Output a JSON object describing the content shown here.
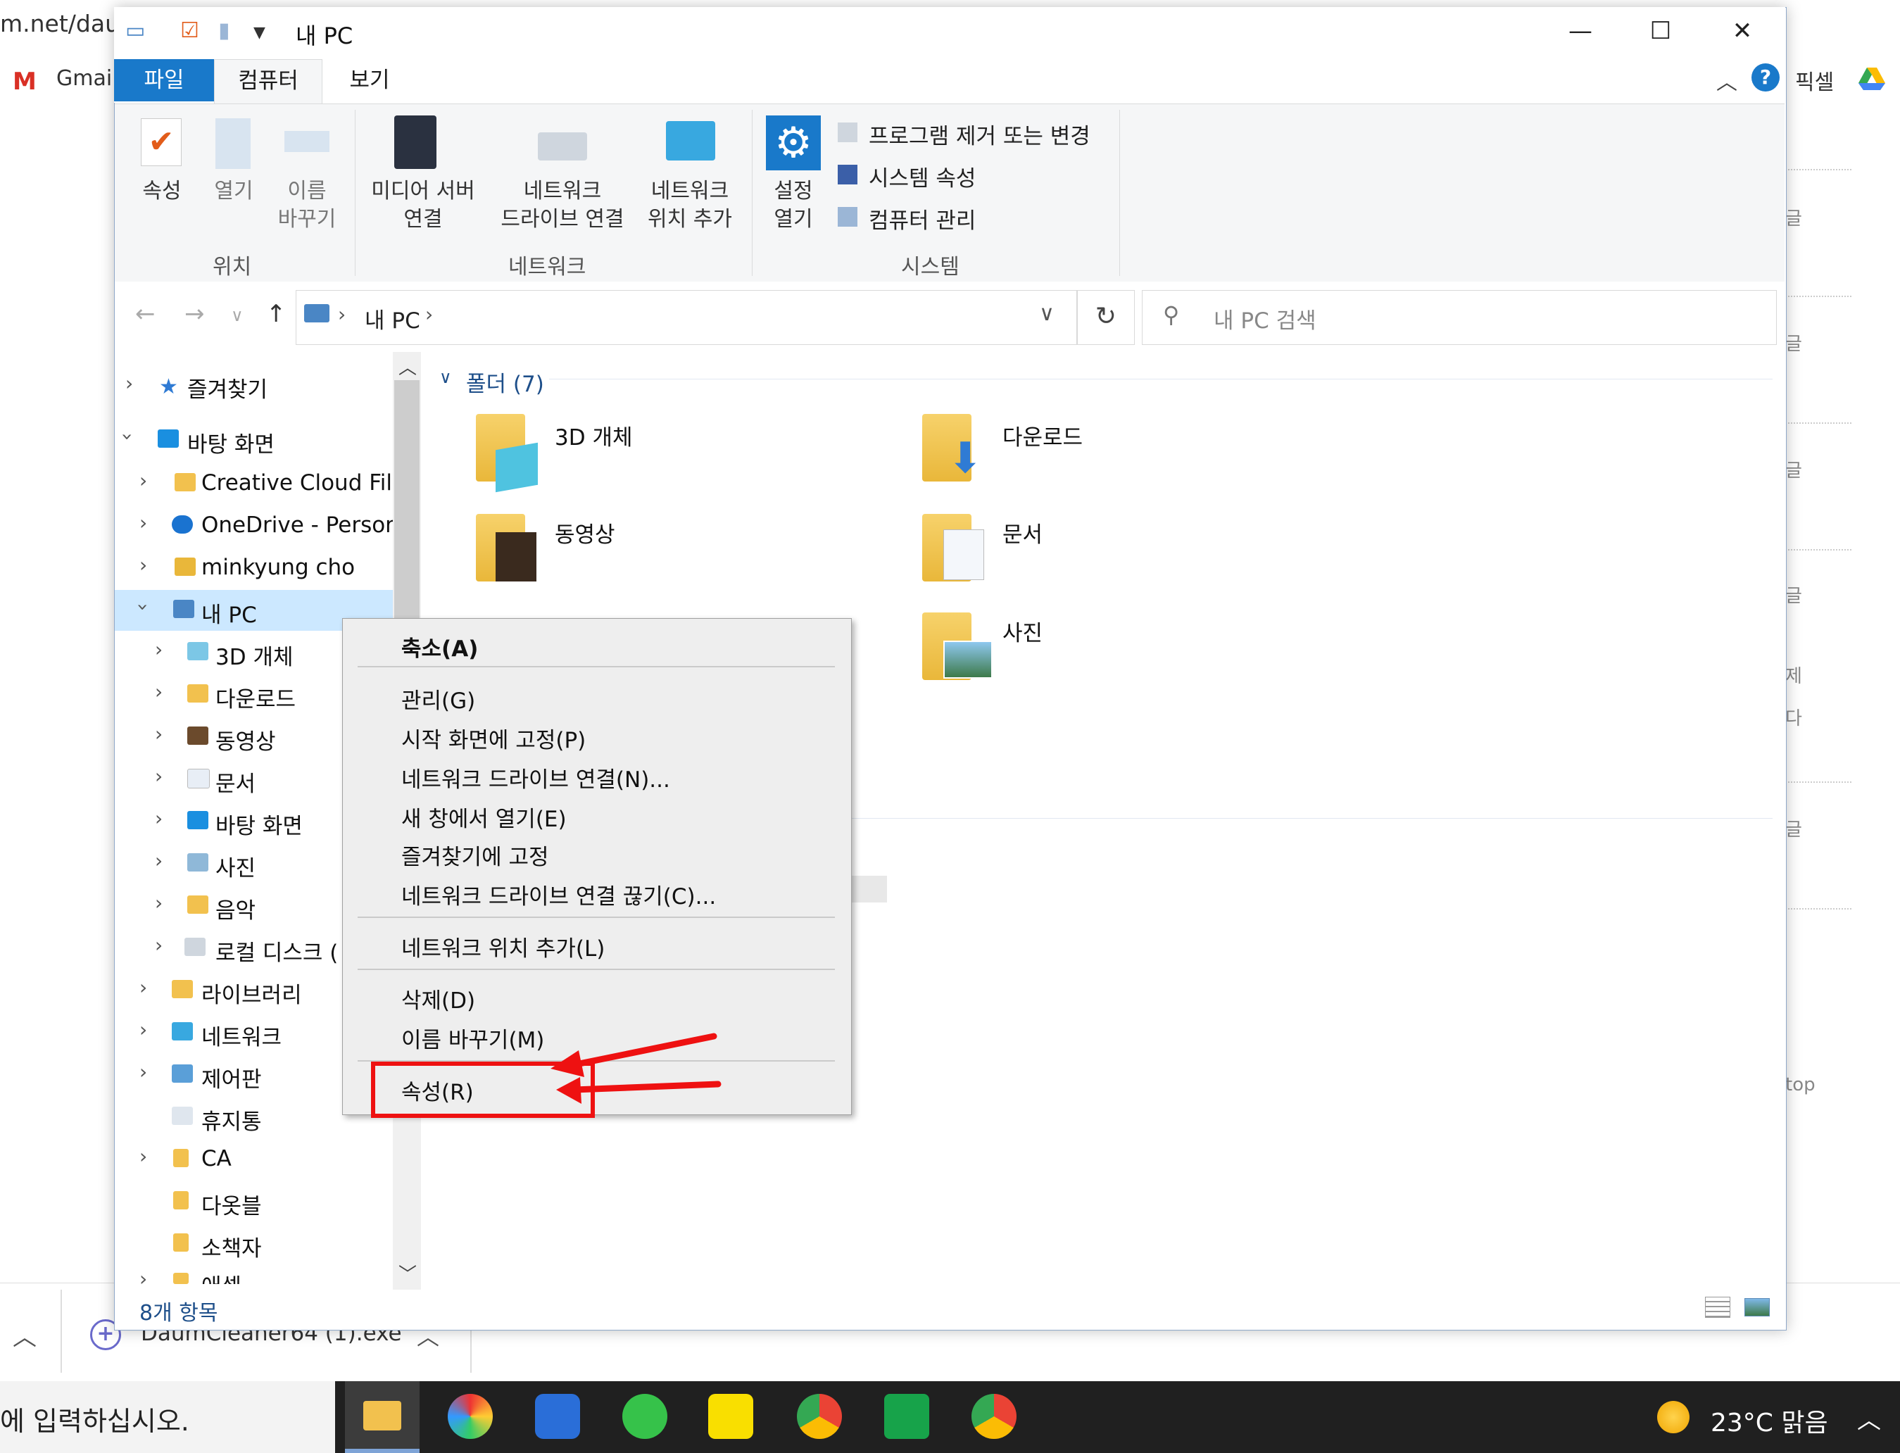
{
  "browser": {
    "url_fragment": "m.net/dau",
    "bookmark_gmail": "Gmail",
    "bookmark_right": "픽셀",
    "side_text": [
      "글",
      "글",
      "글",
      "글",
      "제",
      "다",
      "글",
      "top"
    ]
  },
  "download_shelf": {
    "file_name": "DaumCleaner64 (1).exe"
  },
  "taskbar": {
    "search_text": "에 입력하십시오.",
    "weather": "23°C  맑음"
  },
  "window": {
    "title": "내 PC",
    "controls": [
      "—",
      "☐",
      "✕"
    ]
  },
  "ribbon": {
    "tabs": [
      "파일",
      "컴퓨터",
      "보기"
    ],
    "location_group": "위치",
    "network_group": "네트워크",
    "system_group": "시스템",
    "properties": "속성",
    "open": "열기",
    "rename_1": "이름",
    "rename_2": "바꾸기",
    "media_server_1": "미디어 서버",
    "media_server_2": "연결",
    "map_drive_1": "네트워크",
    "map_drive_2": "드라이브 연결",
    "add_location_1": "네트워크",
    "add_location_2": "위치 추가",
    "settings_1": "설정",
    "settings_2": "열기",
    "uninstall": "프로그램 제거 또는 변경",
    "system_props": "시스템 속성",
    "manage": "컴퓨터 관리"
  },
  "address": {
    "path": "내 PC",
    "search_placeholder": "내 PC 검색"
  },
  "nav_tree": {
    "items": [
      "즐겨찾기",
      "바탕 화면",
      "Creative Cloud Files",
      "OneDrive - Persona",
      "minkyung cho",
      "내 PC",
      "3D 개체",
      "다운로드",
      "동영상",
      "문서",
      "바탕 화면",
      "사진",
      "음악",
      "로컬 디스크 (",
      "라이브러리",
      "네트워크",
      "제어판",
      "휴지통",
      "CA",
      "다옷블",
      "소책자",
      "애셀"
    ]
  },
  "content": {
    "group_header": "폴더 (7)",
    "folders": [
      "3D 개체",
      "다운로드",
      "동영상",
      "문서",
      "사진"
    ]
  },
  "status": {
    "item_count": "8개 항목"
  },
  "context_menu": {
    "items": [
      "축소(A)",
      "관리(G)",
      "시작 화면에 고정(P)",
      "네트워크 드라이브 연결(N)...",
      "새 창에서 열기(E)",
      "즐겨찾기에 고정",
      "네트워크 드라이브 연결 끊기(C)...",
      "네트워크 위치 추가(L)",
      "삭제(D)",
      "이름 바꾸기(M)",
      "속성(R)"
    ]
  },
  "colors": {
    "accent": "#1979ca",
    "highlight": "#ee1111",
    "selection": "#cce8ff"
  }
}
